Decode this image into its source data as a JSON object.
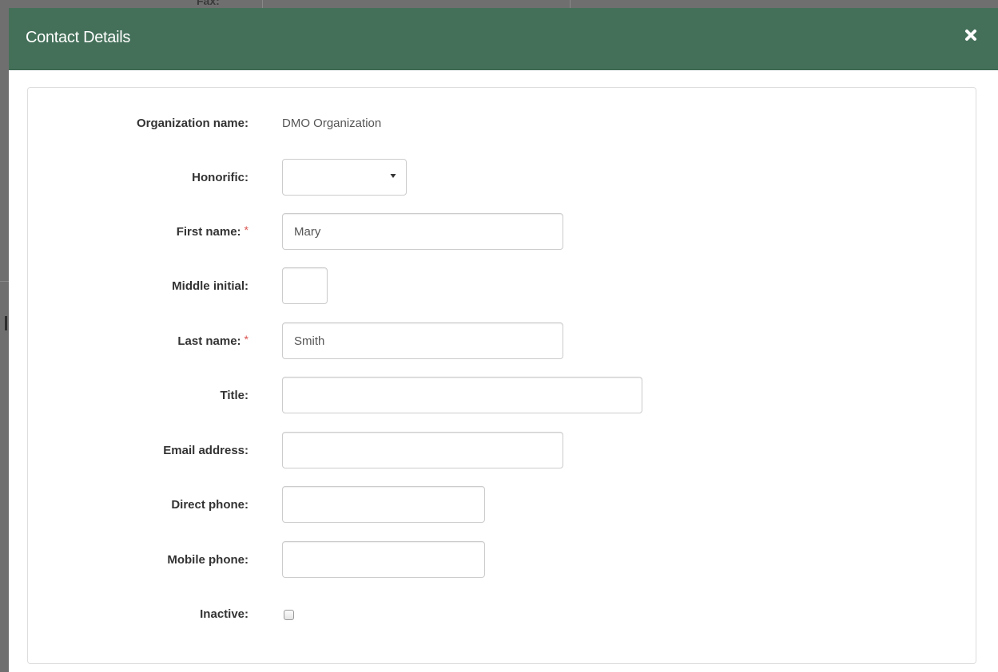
{
  "background": {
    "partial_label": "Fax:"
  },
  "modal": {
    "title": "Contact Details",
    "close_icon": "close-x-icon",
    "header_color": "#447059"
  },
  "form": {
    "organization_name": {
      "label": "Organization name:",
      "value": "DMO Organization"
    },
    "honorific": {
      "label": "Honorific:",
      "value": "",
      "caret_icon": "chevron-down-icon"
    },
    "first_name": {
      "label": "First name:",
      "required_marker": "*",
      "value": "Mary"
    },
    "middle_initial": {
      "label": "Middle initial:",
      "value": ""
    },
    "last_name": {
      "label": "Last name:",
      "required_marker": "*",
      "value": "Smith"
    },
    "title": {
      "label": "Title:",
      "value": ""
    },
    "email_address": {
      "label": "Email address:",
      "value": ""
    },
    "direct_phone": {
      "label": "Direct phone:",
      "value": ""
    },
    "mobile_phone": {
      "label": "Mobile phone:",
      "value": ""
    },
    "inactive": {
      "label": "Inactive:",
      "checked": false
    }
  },
  "colors": {
    "required": "#d9534f",
    "label_text": "#333333",
    "value_text": "#555555"
  }
}
